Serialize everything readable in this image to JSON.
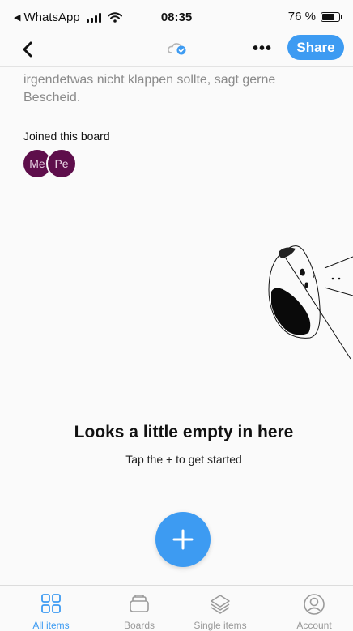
{
  "status_bar": {
    "back_app": "WhatsApp",
    "time": "08:35",
    "battery": "76 %",
    "battery_level": 0.76
  },
  "nav": {
    "back_icon": "chevron-left-icon",
    "sync_icon": "cloud-check-icon",
    "more_label": "•••",
    "share_label": "Share"
  },
  "board": {
    "description": "irgendetwas nicht klappen sollte, sagt gerne Bescheid.",
    "joined_title": "Joined this board",
    "members": [
      {
        "initials": "Me"
      },
      {
        "initials": "Pe"
      }
    ]
  },
  "empty_state": {
    "title": "Looks a little empty in here",
    "subtitle": "Tap the + to get started"
  },
  "fab": {
    "icon": "plus-icon"
  },
  "tabs": [
    {
      "label": "All items",
      "icon": "grid-icon",
      "active": true
    },
    {
      "label": "Boards",
      "icon": "board-tray-icon",
      "active": false
    },
    {
      "label": "Single items",
      "icon": "layers-icon",
      "active": false
    },
    {
      "label": "Account",
      "icon": "user-icon",
      "active": false
    }
  ],
  "colors": {
    "accent": "#3d9bf2",
    "avatar": "#5e0e4b",
    "muted_text": "#8a8a8a"
  }
}
